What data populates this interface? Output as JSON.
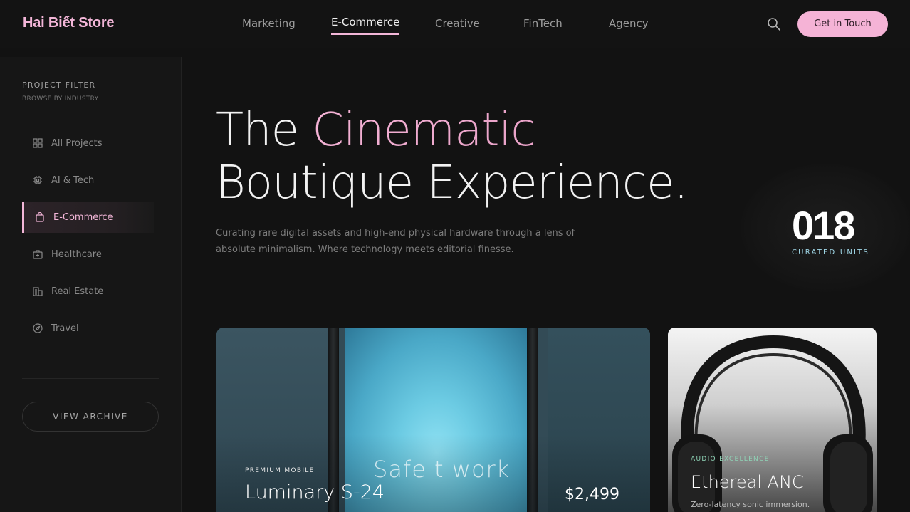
{
  "header": {
    "brand": "Hai Biết Store",
    "nav": [
      "Marketing",
      "E-Commerce",
      "Creative",
      "FinTech",
      "Agency"
    ],
    "active_nav": "E-Commerce",
    "search_icon": "search-icon",
    "cta_label": "Get in Touch",
    "accent_color": "#f5b3d6"
  },
  "sidebar": {
    "title": "PROJECT FILTER",
    "subtitle": "BROWSE BY INDUSTRY",
    "items": [
      {
        "label": "All Projects",
        "icon": "grid-icon"
      },
      {
        "label": "AI & Tech",
        "icon": "chip-icon"
      },
      {
        "label": "E-Commerce",
        "icon": "shopping-bag-icon"
      },
      {
        "label": "Healthcare",
        "icon": "medical-kit-icon"
      },
      {
        "label": "Real Estate",
        "icon": "building-icon"
      },
      {
        "label": "Travel",
        "icon": "compass-icon"
      }
    ],
    "active_item": "E-Commerce",
    "archive_label": "VIEW ARCHIVE"
  },
  "hero": {
    "line1_pre": "The ",
    "line1_accent": "Cinematic",
    "line2": "Boutique Experience.",
    "description": "Curating rare digital assets and high-end physical hardware through a lens of absolute minimalism. Where technology meets editorial finesse."
  },
  "stats": {
    "count": "018",
    "label": "CURATED UNITS"
  },
  "products": [
    {
      "category": "PREMIUM MOBILE",
      "title": "Luminary S-24",
      "price": "$2,499",
      "screen_text": "Safe t work"
    },
    {
      "category": "AUDIO EXCELLENCE",
      "title": "Ethereal ANC",
      "description": "Zero-latency sonic immersion."
    }
  ]
}
